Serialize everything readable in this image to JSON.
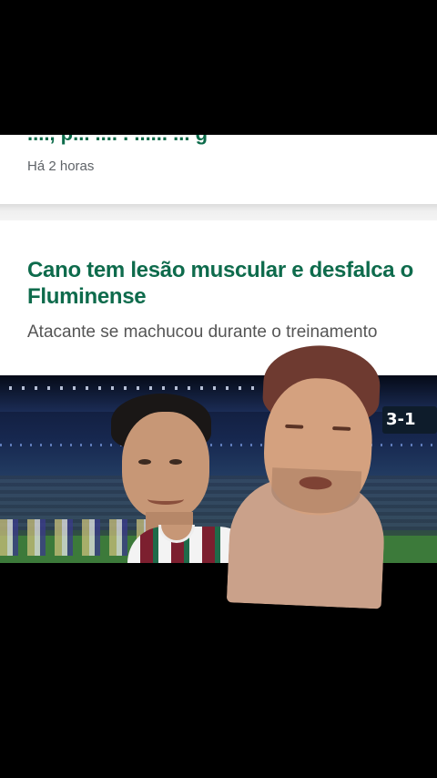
{
  "previous_card": {
    "title_fragment": "...., p... .... . ...... ... g",
    "time": "Há 2 horas"
  },
  "article": {
    "headline": "Cano tem lesão muscular e desfalca o Fluminense",
    "subtitle": "Atacante se machucou durante o treinamento"
  },
  "photo": {
    "scoreboard": "3-1"
  },
  "colors": {
    "headline": "#0e6b4c",
    "subtitle": "#555555",
    "background": "#000000"
  }
}
